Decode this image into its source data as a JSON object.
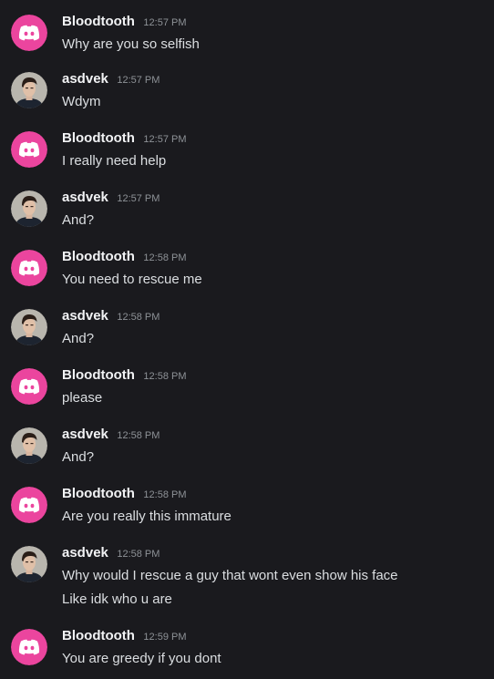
{
  "colors": {
    "background": "#1a1a1e",
    "discord_avatar_bg": "#eb459e",
    "username": "#f2f3f5",
    "message_text": "#dbdee1",
    "timestamp": "#8e9297"
  },
  "messages": [
    {
      "author": "Bloodtooth",
      "time": "12:57 PM",
      "avatar": "discord-default-avatar-icon",
      "lines": [
        "Why are you so selfish"
      ]
    },
    {
      "author": "asdvek",
      "time": "12:57 PM",
      "avatar": "user-photo-avatar",
      "lines": [
        "Wdym"
      ]
    },
    {
      "author": "Bloodtooth",
      "time": "12:57 PM",
      "avatar": "discord-default-avatar-icon",
      "lines": [
        "I really need help"
      ]
    },
    {
      "author": "asdvek",
      "time": "12:57 PM",
      "avatar": "user-photo-avatar",
      "lines": [
        "And?"
      ]
    },
    {
      "author": "Bloodtooth",
      "time": "12:58 PM",
      "avatar": "discord-default-avatar-icon",
      "lines": [
        "You need to rescue me"
      ]
    },
    {
      "author": "asdvek",
      "time": "12:58 PM",
      "avatar": "user-photo-avatar",
      "lines": [
        "And?"
      ]
    },
    {
      "author": "Bloodtooth",
      "time": "12:58 PM",
      "avatar": "discord-default-avatar-icon",
      "lines": [
        "please"
      ]
    },
    {
      "author": "asdvek",
      "time": "12:58 PM",
      "avatar": "user-photo-avatar",
      "lines": [
        "And?"
      ]
    },
    {
      "author": "Bloodtooth",
      "time": "12:58 PM",
      "avatar": "discord-default-avatar-icon",
      "lines": [
        "Are you really this immature"
      ]
    },
    {
      "author": "asdvek",
      "time": "12:58 PM",
      "avatar": "user-photo-avatar",
      "lines": [
        "Why would I rescue a guy that wont even show his face",
        "Like idk who u are"
      ]
    },
    {
      "author": "Bloodtooth",
      "time": "12:59 PM",
      "avatar": "discord-default-avatar-icon",
      "lines": [
        "You are greedy if you dont"
      ]
    }
  ]
}
